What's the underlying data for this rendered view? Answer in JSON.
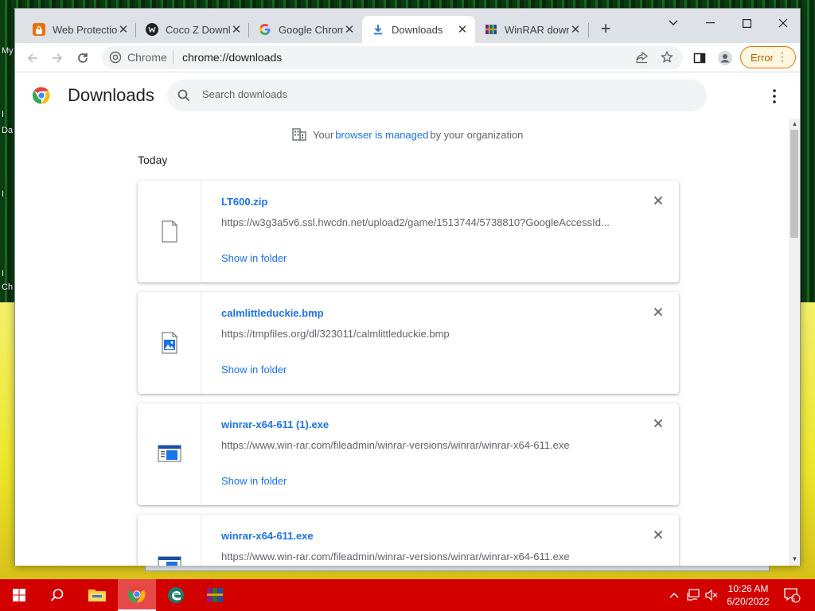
{
  "desktop": {
    "labels": [
      "My",
      "I",
      "Da",
      "I",
      "I",
      "Ch"
    ]
  },
  "tabs": [
    {
      "title": "Web Protection",
      "icon": "lock-shield-icon",
      "color": "#e8710a"
    },
    {
      "title": "Coco Z Downloads",
      "icon": "coco-logo-icon",
      "color": "#202124"
    },
    {
      "title": "Google Chrome",
      "icon": "google-g-icon",
      "color": "#4285f4"
    },
    {
      "title": "Downloads",
      "icon": "download-arrow-icon",
      "color": "#1a73e8"
    },
    {
      "title": "WinRAR download",
      "icon": "winrar-books-icon",
      "color": "#8b1a8b"
    }
  ],
  "new_tab_label": "+",
  "toolbar": {
    "site_label": "Chrome",
    "url": "chrome://downloads",
    "profile_error_label": "Error"
  },
  "page": {
    "title": "Downloads",
    "search_placeholder": "Search downloads",
    "managed": {
      "prefix": "Your ",
      "link": "browser is managed",
      "suffix": " by your organization"
    },
    "section_label": "Today",
    "show_in_folder_label": "Show in folder",
    "downloads": [
      {
        "name": "LT600.zip",
        "url": "https://w3g3a5v6.ssl.hwcdn.net/upload2/game/1513744/5738810?GoogleAccessId...",
        "icon": "generic-file-icon"
      },
      {
        "name": "calmlittleduckie.bmp",
        "url": "https://tmpfiles.org/dl/323011/calmlittleduckie.bmp",
        "icon": "image-file-icon"
      },
      {
        "name": "winrar-x64-611 (1).exe",
        "url": "https://www.win-rar.com/fileadmin/winrar-versions/winrar/winrar-x64-611.exe",
        "icon": "exe-file-icon"
      },
      {
        "name": "winrar-x64-611.exe",
        "url": "https://www.win-rar.com/fileadmin/winrar-versions/winrar/winrar-x64-611.exe",
        "icon": "exe-file-icon"
      }
    ]
  },
  "taskbar": {
    "time": "10:26 AM",
    "date": "6/20/2022",
    "notification_count": "5"
  },
  "colors": {
    "accent": "#1a73e8",
    "taskbar": "#d30000",
    "error": "#b06000"
  }
}
